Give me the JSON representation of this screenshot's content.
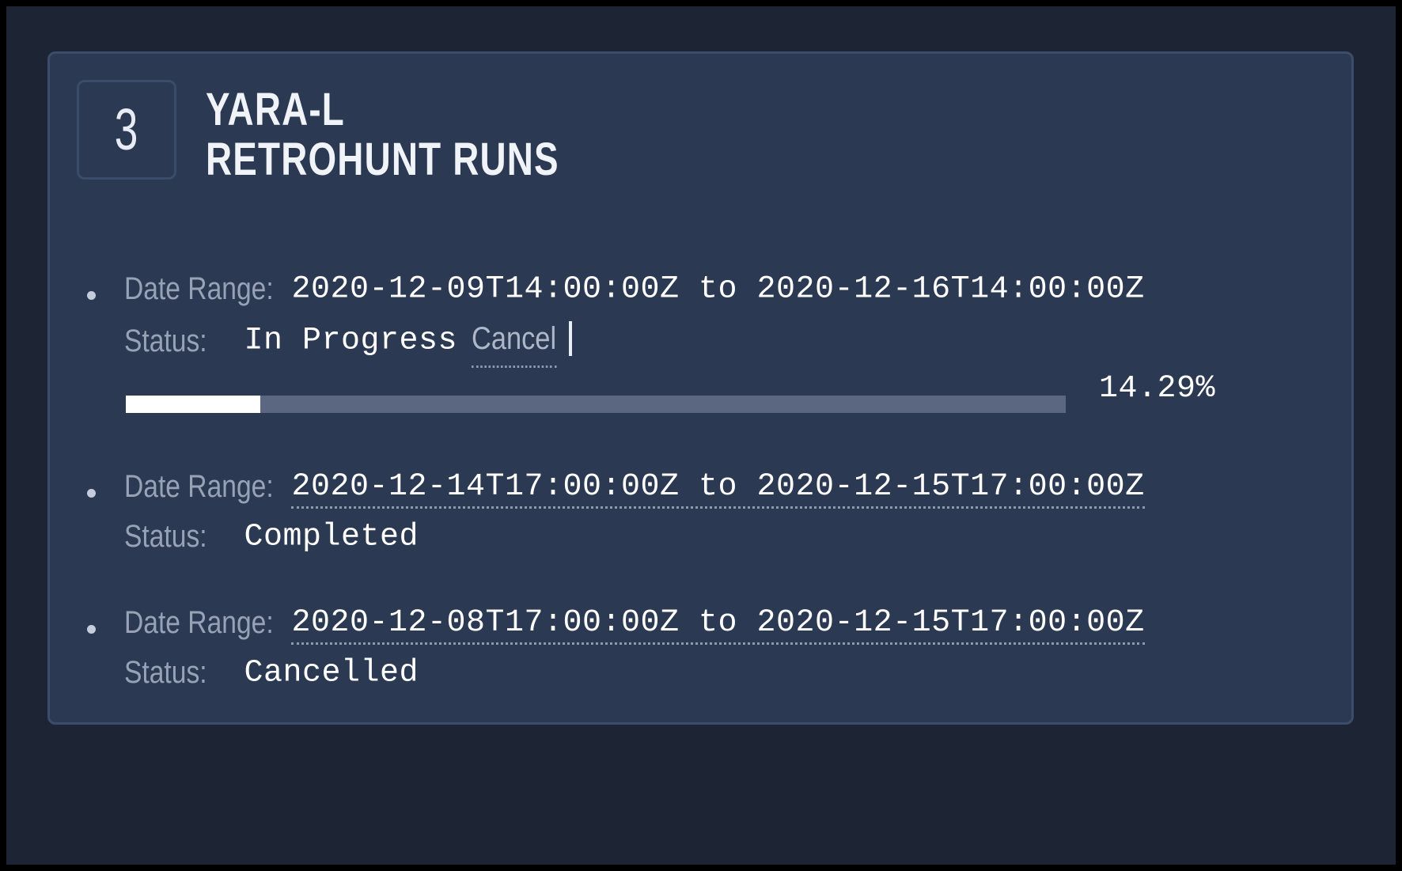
{
  "card": {
    "count": "3",
    "title_line1": "YARA-L",
    "title_line2": "RETROHUNT RUNS",
    "accent_background": "#2b3952",
    "page_background": "#1d2535",
    "border_color": "#3c4c6b",
    "label_color": "#98a2b6",
    "value_color": "#ffffff"
  },
  "labels": {
    "date_range": "Date Range:",
    "status": "Status:"
  },
  "runs": [
    {
      "date_range": "2020-12-09T14:00:00Z to 2020-12-16T14:00:00Z",
      "date_range_underlined": false,
      "status": "In Progress",
      "cancel_label": "Cancel",
      "has_cancel": true,
      "has_caret": true,
      "progress": {
        "percent_label": "14.29%",
        "percent_value": 14.29,
        "fill_color": "#ffffff",
        "track_color": "#5b6781"
      }
    },
    {
      "date_range": "2020-12-14T17:00:00Z to 2020-12-15T17:00:00Z",
      "date_range_underlined": true,
      "status": "Completed",
      "has_cancel": false,
      "has_caret": false
    },
    {
      "date_range": "2020-12-08T17:00:00Z to 2020-12-15T17:00:00Z",
      "date_range_underlined": true,
      "status": "Cancelled",
      "has_cancel": false,
      "has_caret": false
    }
  ]
}
